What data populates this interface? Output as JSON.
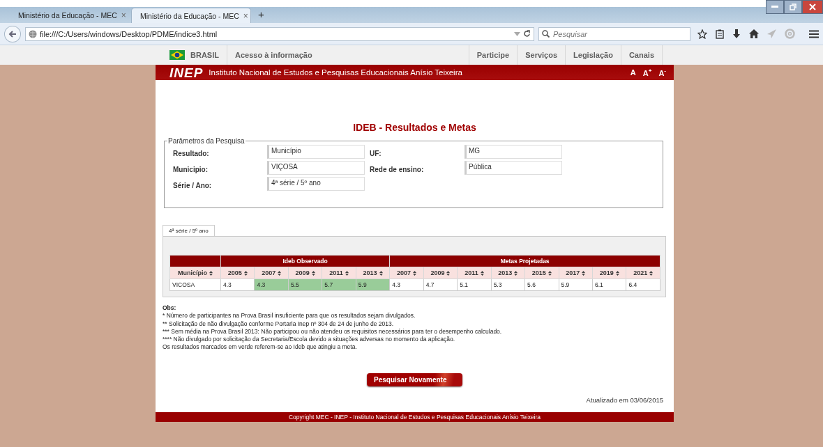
{
  "browser": {
    "tabs": [
      {
        "title": "Ministério da Educação - MEC",
        "close": "×",
        "selected": false
      },
      {
        "title": "Ministério da Educação - MEC",
        "close": "×",
        "selected": true
      }
    ],
    "new_tab": "+",
    "address": "file:///C:/Users/windows/Desktop/PDME/indice3.html",
    "search": {
      "placeholder": "Pesquisar"
    }
  },
  "gov_bar": {
    "country": "BRASIL",
    "left_links": [
      "Acesso à informação"
    ],
    "right_links": [
      "Participe",
      "Serviços",
      "Legislação",
      "Canais"
    ]
  },
  "header": {
    "logo": "INEP",
    "title": "Instituto Nacional de Estudos e Pesquisas Educacionais Anísio Teixeira",
    "font_controls": [
      "A",
      "A$^{+}$",
      "A$^{-}$"
    ]
  },
  "page_title": "IDEB - Resultados e Metas",
  "params": {
    "legend": "Parâmetros da Pesquisa",
    "fields": [
      {
        "label": "Resultado:",
        "value": "Município"
      },
      {
        "label": "UF:",
        "value": "MG"
      },
      {
        "label": "Municipio:",
        "value": "VIÇOSA"
      },
      {
        "label": "Rede de ensino:",
        "value": "Pública"
      },
      {
        "label": "Série / Ano:",
        "value": "4ª série / 5º ano"
      }
    ]
  },
  "result_tabs": [
    {
      "label": "4ª série / 5º ano",
      "selected": true
    }
  ],
  "table": {
    "first_column": "Município",
    "groups": [
      {
        "label": "Ideb Observado",
        "columns": [
          "2005",
          "2007",
          "2009",
          "2011",
          "2013"
        ]
      },
      {
        "label": "Metas Projetadas",
        "columns": [
          "2007",
          "2009",
          "2011",
          "2013",
          "2015",
          "2017",
          "2019",
          "2021"
        ]
      }
    ],
    "rows": [
      {
        "name": "VICOSA",
        "observed": [
          {
            "value": "4.3",
            "met": false
          },
          {
            "value": "4.3",
            "met": true
          },
          {
            "value": "5.5",
            "met": true
          },
          {
            "value": "5.7",
            "met": true
          },
          {
            "value": "5.9",
            "met": true
          }
        ],
        "targets": [
          "4.3",
          "4.7",
          "5.1",
          "5.3",
          "5.6",
          "5.9",
          "6.1",
          "6.4"
        ]
      }
    ]
  },
  "obs": {
    "title": "Obs:",
    "lines": [
      "* Número de participantes na Prova Brasil insuficiente para que os resultados sejam divulgados.",
      "** Solicitação de não divulgação conforme Portaria Inep nº 304 de 24 de junho de 2013.",
      "*** Sem média na Prova Brasil 2013: Não participou ou não atendeu os requisitos necessários para ter o desempenho calculado.",
      "**** Não divulgado por solicitação da Secretaria/Escola devido a situações adversas no momento da aplicação.",
      "Os resultados marcados em verde referem-se ao Ideb que atingiu a meta."
    ]
  },
  "search_again_button": "Pesquisar Novamente",
  "updated": "Atualizado em 03/06/2015",
  "footer": "Copyright MEC - INEP - Instituto Nacional de Estudos e Pesquisas Educacionais Anísio Teixeira"
}
